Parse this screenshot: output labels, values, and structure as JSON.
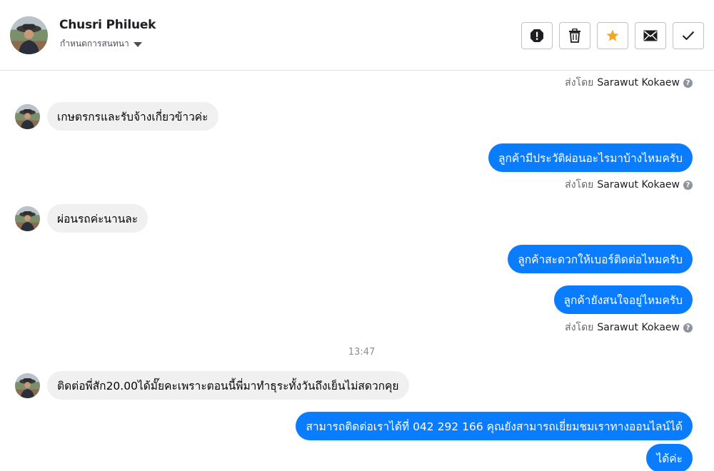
{
  "header": {
    "contact_name": "Chusri Philuek",
    "subtitle": "กำหนดการสนทนา",
    "actions": [
      {
        "icon": "alert-icon",
        "label": ""
      },
      {
        "icon": "trash-icon",
        "label": ""
      },
      {
        "icon": "star-icon",
        "label": ""
      },
      {
        "icon": "mail-icon",
        "label": ""
      },
      {
        "icon": "check-icon",
        "label": ""
      }
    ]
  },
  "colors": {
    "accent": "#0a7cff",
    "star": "#f5a623",
    "incoming_bubble": "#f0f0f0"
  },
  "messages": {
    "sent_by_prefix": "ส่งโดย",
    "sent_by_name": "Sarawut Kokaew",
    "help_glyph": "?",
    "m1": "เกษตรกรและรับจ้างเกี่ยวข้าวค่ะ",
    "m2": "ลูกค้ามีประวัติผ่อนอะไรมาบ้างไหมครับ",
    "m3": "ผ่อนรถค่ะนานละ",
    "m4": "ลูกค้าสะดวกให้เบอร์ติดต่อไหมครับ",
    "m5": "ลูกค้ายังสนใจอยู่ไหมครับ",
    "timestamp": "13:47",
    "m6": "ติดต่อพี่สัก20.00ได้มั๊ยคะเพราะตอนนี้พี่มาทำธุระทั้งวันถึงเย็นไม่สดวกคุย",
    "m7": "สามารถติดต่อเราได้ที่ 042 292 166 คุณยังสามารถเยี่ยมชมเราทางออนไลน์ได้",
    "m8": "ได้ค่ะ"
  }
}
